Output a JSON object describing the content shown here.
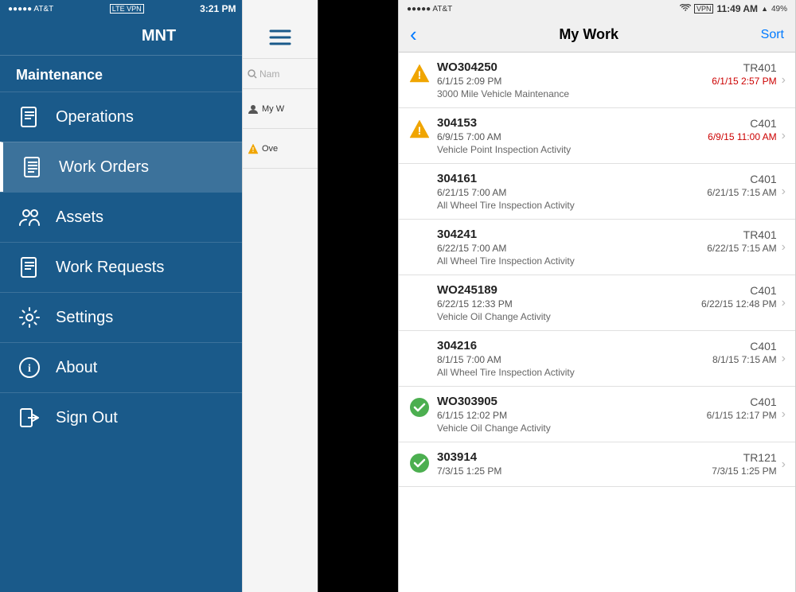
{
  "left_phone": {
    "status_bar": {
      "carrier": "●●●●● AT&T",
      "network": "LTE VPN",
      "time": "3:21 PM",
      "battery": "▮▮▮▮"
    },
    "header": {
      "title": "MNT"
    },
    "sidebar": {
      "section_title": "Maintenance",
      "items": [
        {
          "id": "operations",
          "label": "Operations",
          "icon": "doc"
        },
        {
          "id": "work-orders",
          "label": "Work Orders",
          "icon": "list",
          "active": true
        },
        {
          "id": "assets",
          "label": "Assets",
          "icon": "people"
        },
        {
          "id": "work-requests",
          "label": "Work Requests",
          "icon": "doc"
        },
        {
          "id": "settings",
          "label": "Settings",
          "icon": "gear"
        },
        {
          "id": "about",
          "label": "About",
          "icon": "info"
        },
        {
          "id": "sign-out",
          "label": "Sign Out",
          "icon": "door"
        }
      ]
    }
  },
  "right_phone": {
    "status_bar": {
      "carrier": "●●●●● AT&T",
      "wifi": "WiFi",
      "network": "VPN",
      "time": "11:49 AM",
      "battery": "49%"
    },
    "nav": {
      "back_label": "‹",
      "title": "My Work",
      "sort_label": "Sort"
    },
    "work_items": [
      {
        "id": "WO304250",
        "code": "TR401",
        "date_start": "6/1/15 2:09 PM",
        "date_end": "6/1/15 2:57 PM",
        "desc": "3000 Mile Vehicle Maintenance",
        "status": "warning",
        "date_end_red": true
      },
      {
        "id": "304153",
        "code": "C401",
        "date_start": "6/9/15 7:00 AM",
        "date_end": "6/9/15 11:00 AM",
        "desc": "Vehicle Point Inspection Activity",
        "status": "warning",
        "date_end_red": true
      },
      {
        "id": "304161",
        "code": "C401",
        "date_start": "6/21/15 7:00 AM",
        "date_end": "6/21/15 7:15 AM",
        "desc": "All Wheel Tire Inspection Activity",
        "status": "none",
        "date_end_red": false
      },
      {
        "id": "304241",
        "code": "TR401",
        "date_start": "6/22/15 7:00 AM",
        "date_end": "6/22/15 7:15 AM",
        "desc": "All Wheel Tire Inspection Activity",
        "status": "none",
        "date_end_red": false
      },
      {
        "id": "WO245189",
        "code": "C401",
        "date_start": "6/22/15 12:33 PM",
        "date_end": "6/22/15 12:48 PM",
        "desc": "Vehicle Oil Change Activity",
        "status": "none",
        "date_end_red": false
      },
      {
        "id": "304216",
        "code": "C401",
        "date_start": "8/1/15 7:00 AM",
        "date_end": "8/1/15 7:15 AM",
        "desc": "All Wheel Tire Inspection Activity",
        "status": "none",
        "date_end_red": false
      },
      {
        "id": "WO303905",
        "code": "C401",
        "date_start": "6/1/15 12:02 PM",
        "date_end": "6/1/15 12:17 PM",
        "desc": "Vehicle Oil Change Activity",
        "status": "check",
        "date_end_red": false
      },
      {
        "id": "303914",
        "code": "TR121",
        "date_start": "7/3/15 1:25 PM",
        "date_end": "7/3/15 1:25 PM",
        "desc": "",
        "status": "check",
        "date_end_red": false
      }
    ],
    "overlay": {
      "search_placeholder": "Nam",
      "tab1": "My W",
      "tab2": "Ove"
    }
  }
}
